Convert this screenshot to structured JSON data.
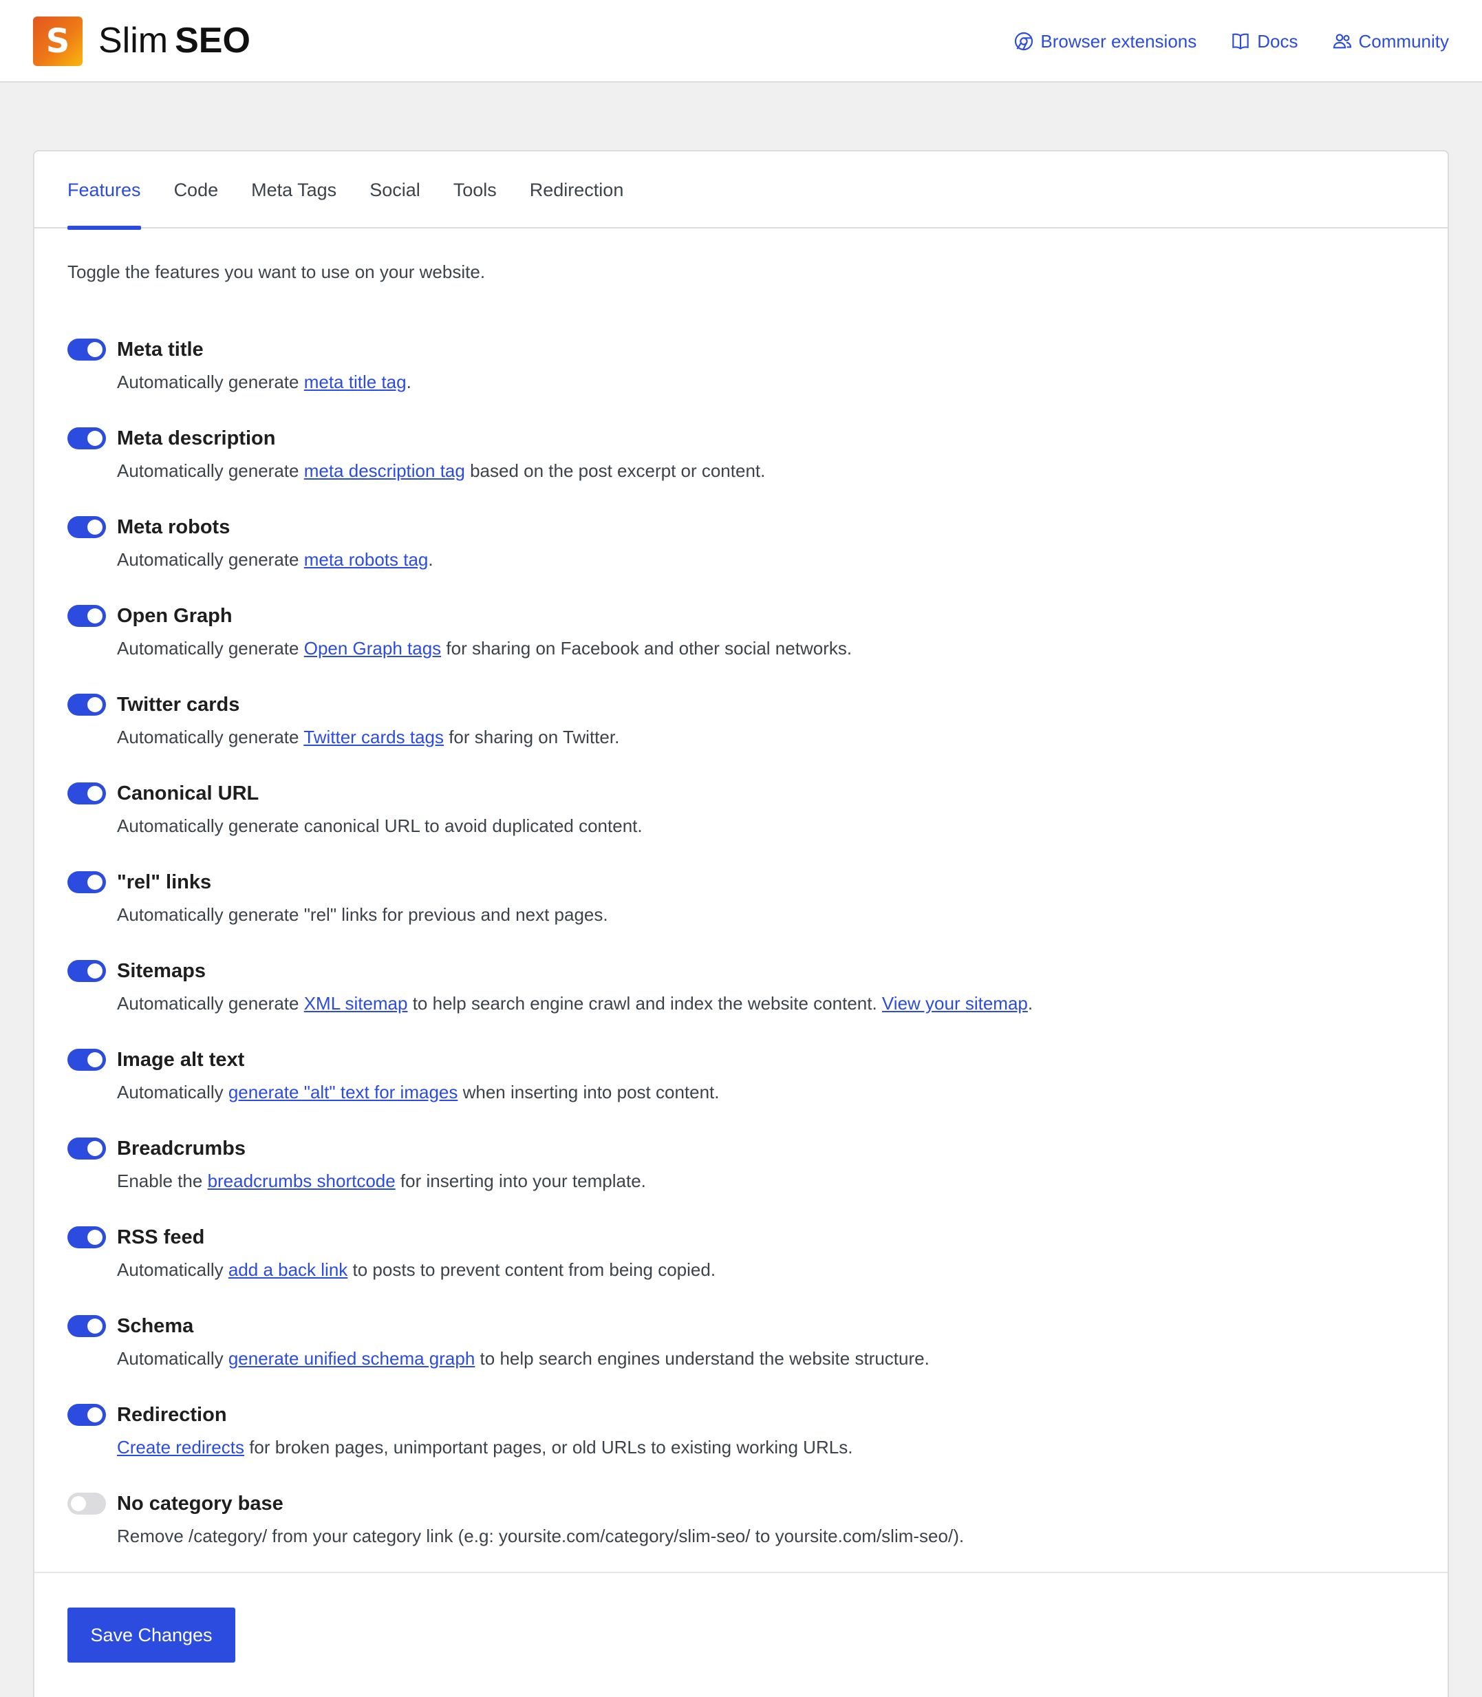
{
  "header": {
    "logo_letter": "S",
    "brand_light": "Slim",
    "brand_bold": "SEO",
    "links": [
      {
        "label": "Browser extensions",
        "icon": "chrome-icon"
      },
      {
        "label": "Docs",
        "icon": "book-icon"
      },
      {
        "label": "Community",
        "icon": "users-icon"
      }
    ]
  },
  "tabs": [
    {
      "label": "Features",
      "active": true
    },
    {
      "label": "Code",
      "active": false
    },
    {
      "label": "Meta Tags",
      "active": false
    },
    {
      "label": "Social",
      "active": false
    },
    {
      "label": "Tools",
      "active": false
    },
    {
      "label": "Redirection",
      "active": false
    }
  ],
  "intro": "Toggle the features you want to use on your website.",
  "features": [
    {
      "title": "Meta title",
      "enabled": true,
      "desc": [
        {
          "t": "Automatically generate "
        },
        {
          "link": "meta title tag"
        },
        {
          "t": "."
        }
      ]
    },
    {
      "title": "Meta description",
      "enabled": true,
      "desc": [
        {
          "t": "Automatically generate "
        },
        {
          "link": "meta description tag"
        },
        {
          "t": " based on the post excerpt or content."
        }
      ]
    },
    {
      "title": "Meta robots",
      "enabled": true,
      "desc": [
        {
          "t": "Automatically generate "
        },
        {
          "link": "meta robots tag"
        },
        {
          "t": "."
        }
      ]
    },
    {
      "title": "Open Graph",
      "enabled": true,
      "desc": [
        {
          "t": "Automatically generate "
        },
        {
          "link": "Open Graph tags"
        },
        {
          "t": " for sharing on Facebook and other social networks."
        }
      ]
    },
    {
      "title": "Twitter cards",
      "enabled": true,
      "desc": [
        {
          "t": "Automatically generate "
        },
        {
          "link": "Twitter cards tags"
        },
        {
          "t": " for sharing on Twitter."
        }
      ]
    },
    {
      "title": "Canonical URL",
      "enabled": true,
      "desc": [
        {
          "t": "Automatically generate canonical URL to avoid duplicated content."
        }
      ]
    },
    {
      "title": "\"rel\" links",
      "enabled": true,
      "desc": [
        {
          "t": "Automatically generate \"rel\" links for previous and next pages."
        }
      ]
    },
    {
      "title": "Sitemaps",
      "enabled": true,
      "desc": [
        {
          "t": "Automatically generate "
        },
        {
          "link": "XML sitemap"
        },
        {
          "t": " to help search engine crawl and index the website content. "
        },
        {
          "link": "View your sitemap"
        },
        {
          "t": "."
        }
      ]
    },
    {
      "title": "Image alt text",
      "enabled": true,
      "desc": [
        {
          "t": "Automatically "
        },
        {
          "link": "generate \"alt\" text for images"
        },
        {
          "t": " when inserting into post content."
        }
      ]
    },
    {
      "title": "Breadcrumbs",
      "enabled": true,
      "desc": [
        {
          "t": "Enable the "
        },
        {
          "link": "breadcrumbs shortcode"
        },
        {
          "t": " for inserting into your template."
        }
      ]
    },
    {
      "title": "RSS feed",
      "enabled": true,
      "desc": [
        {
          "t": "Automatically "
        },
        {
          "link": "add a back link"
        },
        {
          "t": " to posts to prevent content from being copied."
        }
      ]
    },
    {
      "title": "Schema",
      "enabled": true,
      "desc": [
        {
          "t": "Automatically "
        },
        {
          "link": "generate unified schema graph"
        },
        {
          "t": " to help search engines understand the website structure."
        }
      ]
    },
    {
      "title": "Redirection",
      "enabled": true,
      "desc": [
        {
          "link": "Create redirects"
        },
        {
          "t": " for broken pages, unimportant pages, or old URLs to existing working URLs."
        }
      ]
    },
    {
      "title": "No category base",
      "enabled": false,
      "desc": [
        {
          "t": "Remove /category/ from your category link (e.g: yoursite.com/category/slim-seo/ to yoursite.com/slim-seo/)."
        }
      ]
    }
  ],
  "save_label": "Save Changes",
  "colors": {
    "accent": "#2c4cdf",
    "toggle_off": "#dcdcde",
    "background": "#f0f0f1"
  }
}
